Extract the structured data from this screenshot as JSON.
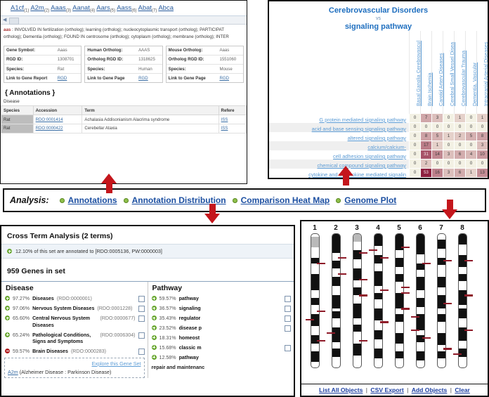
{
  "top_left": {
    "gene_links": [
      {
        "name": "A1cf",
        "num": "(1)"
      },
      {
        "name": "A2m",
        "num": "(2)"
      },
      {
        "name": "Aaas",
        "num": "(3)"
      },
      {
        "name": "Aanat",
        "num": "(4)"
      },
      {
        "name": "Aars",
        "num": "(5)"
      },
      {
        "name": "Aass",
        "num": "(6)"
      },
      {
        "name": "Abat",
        "num": "(7)"
      },
      {
        "name": "Abca",
        "num": ""
      }
    ],
    "summary_gene": "aas",
    "summary_line1": " : INVOLVED IN fertilization (ortholog); learning (ortholog); nucleocytoplasmic transport (ortholog); PARTICIPAT",
    "summary_line2": "ortholog); Dementia (ortholog); FOUND IN centrosome (ortholog); cytoplasm (ortholog); membrane (ortholog); INTER",
    "cards": [
      {
        "rows": [
          {
            "k": "Gene Symbol:",
            "v": "Aaas"
          },
          {
            "k": "RGD ID:",
            "v": "1308701"
          },
          {
            "k": "Species:",
            "v": "Rat"
          },
          {
            "k": "Link to Gene Report",
            "v": "RGD",
            "link": true
          }
        ]
      },
      {
        "rows": [
          {
            "k": "Human Ortholog:",
            "v": "AAAS"
          },
          {
            "k": "Ortholog RGD ID:",
            "v": "1318625"
          },
          {
            "k": "Species:",
            "v": "Human"
          },
          {
            "k": "Link to Gene Page",
            "v": "RGD",
            "link": true
          }
        ]
      },
      {
        "rows": [
          {
            "k": "Mouse Ortholog:",
            "v": "Aaas"
          },
          {
            "k": "Ortholog RGD ID:",
            "v": "1551060"
          },
          {
            "k": "Species:",
            "v": "Mouse"
          },
          {
            "k": "Link to Gene Page",
            "v": "RGD",
            "link": true
          }
        ]
      }
    ],
    "annotations_header": "{ Annotations }",
    "annotations_subtitle": "Disease",
    "ann_columns": [
      "Species",
      "Accession",
      "Term",
      "Refere"
    ],
    "ann_rows": [
      {
        "species": "Rat",
        "accession": "RDO:0001414",
        "term": "Achalasia Addisonianism Alacrima syndrome",
        "ref": "ISS"
      },
      {
        "species": "Rat",
        "accession": "RDO:0000422",
        "term": "Cerebellar Ataxia",
        "ref": "ISS"
      }
    ]
  },
  "heatmap": {
    "title_top": "Cerebrovascular Disorders",
    "vs": "vs",
    "title_bottom": "signaling pathway",
    "columns": [
      "Basal Ganglia Cerebrovascul",
      "Brain Ischemia",
      "Carotid Artery Diseases",
      "Cerebral Small Vessel Disea",
      "Cerebrovascular Trauma",
      "Dementia, Vascular",
      "Intracranial Arterial Diseases"
    ],
    "rows": [
      "G protein mediated signaling pathway",
      "acid and base sensing signaling pathway",
      "altered signaling pathway",
      "calcium/calcium-",
      "cell adhesion signaling pathway",
      "chemical compound signaling pathway",
      "cytokine and chemokine mediated signalin"
    ],
    "values": [
      [
        0,
        7,
        3,
        0,
        1,
        0,
        1
      ],
      [
        0,
        0,
        0,
        0,
        0,
        0,
        0
      ],
      [
        0,
        8,
        5,
        1,
        2,
        5,
        8
      ],
      [
        0,
        17,
        1,
        0,
        0,
        0,
        3
      ],
      [
        0,
        31,
        14,
        3,
        6,
        4,
        10
      ],
      [
        0,
        2,
        0,
        0,
        0,
        0,
        0
      ],
      [
        0,
        53,
        16,
        3,
        6,
        1,
        13
      ]
    ],
    "max_value": 53
  },
  "analysis_bar": {
    "label": "Analysis:",
    "items": [
      {
        "label": "Annotations"
      },
      {
        "label": "Annotation Distribution"
      },
      {
        "label": "Comparison Heat Map"
      },
      {
        "label": "Genome Plot"
      }
    ]
  },
  "cross_term": {
    "title": "Cross Term Analysis (2 terms)",
    "note": "12.10% of this set are annotated to [RDO:0005136, PW:0000003]",
    "gene_count": "959 Genes in set",
    "disease_header": "Disease",
    "pathway_header": "Pathway",
    "disease_rows": [
      {
        "sign": "plus",
        "pct": "97.27%",
        "name": "Diseases",
        "id": "(RDO:0000001)",
        "checkbox": true
      },
      {
        "sign": "plus",
        "pct": "97.06%",
        "name": "Nervous System Diseases",
        "id": "(RDO:0001228)",
        "checkbox": true
      },
      {
        "sign": "plus",
        "pct": "65.60%",
        "name": "Central Nervous System Diseases",
        "id": "(RDO:0000677)",
        "checkbox": true
      },
      {
        "sign": "plus",
        "pct": "65.24%",
        "name": "Pathological Conditions, Signs and Symptoms",
        "id": "(RDO:0006304)",
        "checkbox": true
      },
      {
        "sign": "minus",
        "pct": "59.57%",
        "name": "Brain Diseases",
        "id": "(RDO:0000283)",
        "checkbox": true
      }
    ],
    "explore_link": "Explore this Gene Set",
    "explore_gene": "A2m",
    "explore_terms": "(Alzheimer Disease :  Parkinson Disease)",
    "pathway_rows": [
      {
        "sign": "plus",
        "pct": "59.57%",
        "name": "pathway",
        "checkbox": true
      },
      {
        "sign": "plus",
        "pct": "36.57%",
        "name": "signaling",
        "checkbox": true
      },
      {
        "sign": "plus",
        "pct": "35.43%",
        "name": "regulator",
        "checkbox": true
      },
      {
        "sign": "plus",
        "pct": "23.52%",
        "name": "disease p",
        "checkbox": true
      },
      {
        "sign": "plus",
        "pct": "18.31%",
        "name": "homeost",
        "checkbox": false
      },
      {
        "sign": "plus",
        "pct": "15.68%",
        "name": "classic m",
        "checkbox": true
      },
      {
        "sign": "plus",
        "pct": "12.58%",
        "name": "pathway",
        "checkbox": false
      }
    ],
    "pathway_tail": "repair and maintenanc"
  },
  "genome_plot": {
    "chromosomes": [
      "1",
      "2",
      "3",
      "4",
      "5",
      "6",
      "7",
      "8"
    ],
    "footer_links": [
      "List All Objects",
      "CSV Export",
      "Add Objects",
      "Clear"
    ],
    "separator": "|"
  },
  "colors": {
    "arrow": "#c4161c",
    "link": "#1c4fa1",
    "heat_max": "#8e2040",
    "accent_blue": "#1f6fbf"
  }
}
